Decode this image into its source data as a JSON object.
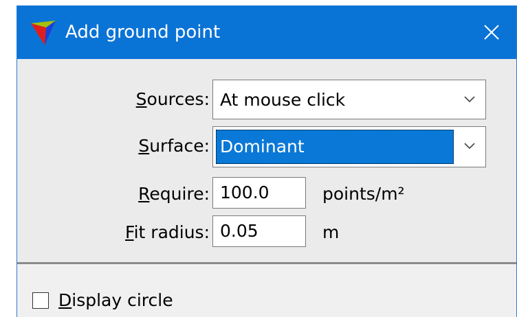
{
  "window": {
    "title": "Add ground point",
    "close_glyph": "✕",
    "icon": "terrasolid-triangle-icon"
  },
  "form": {
    "sources": {
      "label": "Sources:",
      "mnemonic": "S",
      "label_rest": "ources:",
      "value": "At mouse click"
    },
    "surface": {
      "label": "Surface:",
      "mnemonic": "S",
      "label_rest": "urface:",
      "value": "Dominant"
    },
    "require": {
      "label": "Require:",
      "mnemonic": "R",
      "label_rest": "equire:",
      "value": "100.0",
      "unit": "points/m²"
    },
    "fit_radius": {
      "label": "Fit radius:",
      "mnemonic": "F",
      "label_rest": "it radius:",
      "value": "0.05",
      "unit": "m"
    }
  },
  "options": {
    "display_circle": {
      "label": "Display circle",
      "mnemonic": "D",
      "label_rest": "isplay circle",
      "checked": false
    }
  },
  "colors": {
    "titlebar": "#0a73d6",
    "selection": "#0a78d7",
    "dialog_bg": "#ebebeb"
  }
}
